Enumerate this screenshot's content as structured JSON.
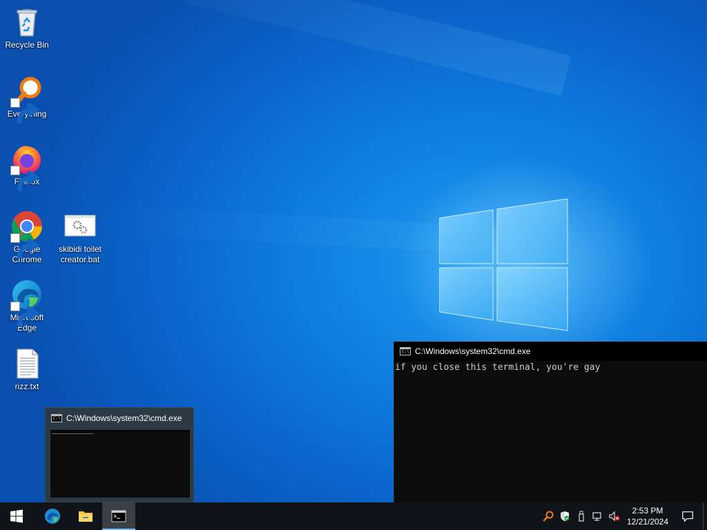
{
  "desktop": {
    "icons": [
      {
        "label": "Recycle Bin",
        "icon": "recycle-bin-icon",
        "shortcut": false
      },
      {
        "label": "Everything",
        "icon": "everything-search-icon",
        "shortcut": true
      },
      {
        "label": "Firefox",
        "icon": "firefox-icon",
        "shortcut": true
      },
      {
        "label": "Google\nChrome",
        "icon": "chrome-icon",
        "shortcut": true
      },
      {
        "label": "skibidi toilet\ncreator.bat",
        "icon": "batch-file-icon",
        "shortcut": false
      },
      {
        "label": "Microsoft\nEdge",
        "icon": "edge-icon",
        "shortcut": true
      },
      {
        "label": "rizz.txt",
        "icon": "text-file-icon",
        "shortcut": false
      }
    ]
  },
  "cmd_window": {
    "title": "C:\\Windows\\system32\\cmd.exe",
    "icon_text": "C:\\",
    "output": "if you close this terminal, you're gay"
  },
  "taskbar_preview": {
    "title": "C:\\Windows\\system32\\cmd.exe"
  },
  "taskbar": {
    "start": "windows-start-icon",
    "pinned": [
      {
        "name": "edge-taskbar-icon",
        "active": false
      },
      {
        "name": "file-explorer-icon",
        "active": false
      },
      {
        "name": "cmd-taskbar-icon",
        "active": true
      }
    ],
    "tray": [
      "everything-tray-icon",
      "windows-security-icon",
      "usb-eject-icon",
      "network-icon",
      "volume-muted-icon"
    ],
    "clock": {
      "time": "2:53 PM",
      "date": "12/21/2024"
    }
  },
  "colors": {
    "desktop_blue": "#0a6fd6",
    "taskbar": "#101418",
    "console_bg": "#0c0c0c",
    "console_text": "#cccccc"
  }
}
